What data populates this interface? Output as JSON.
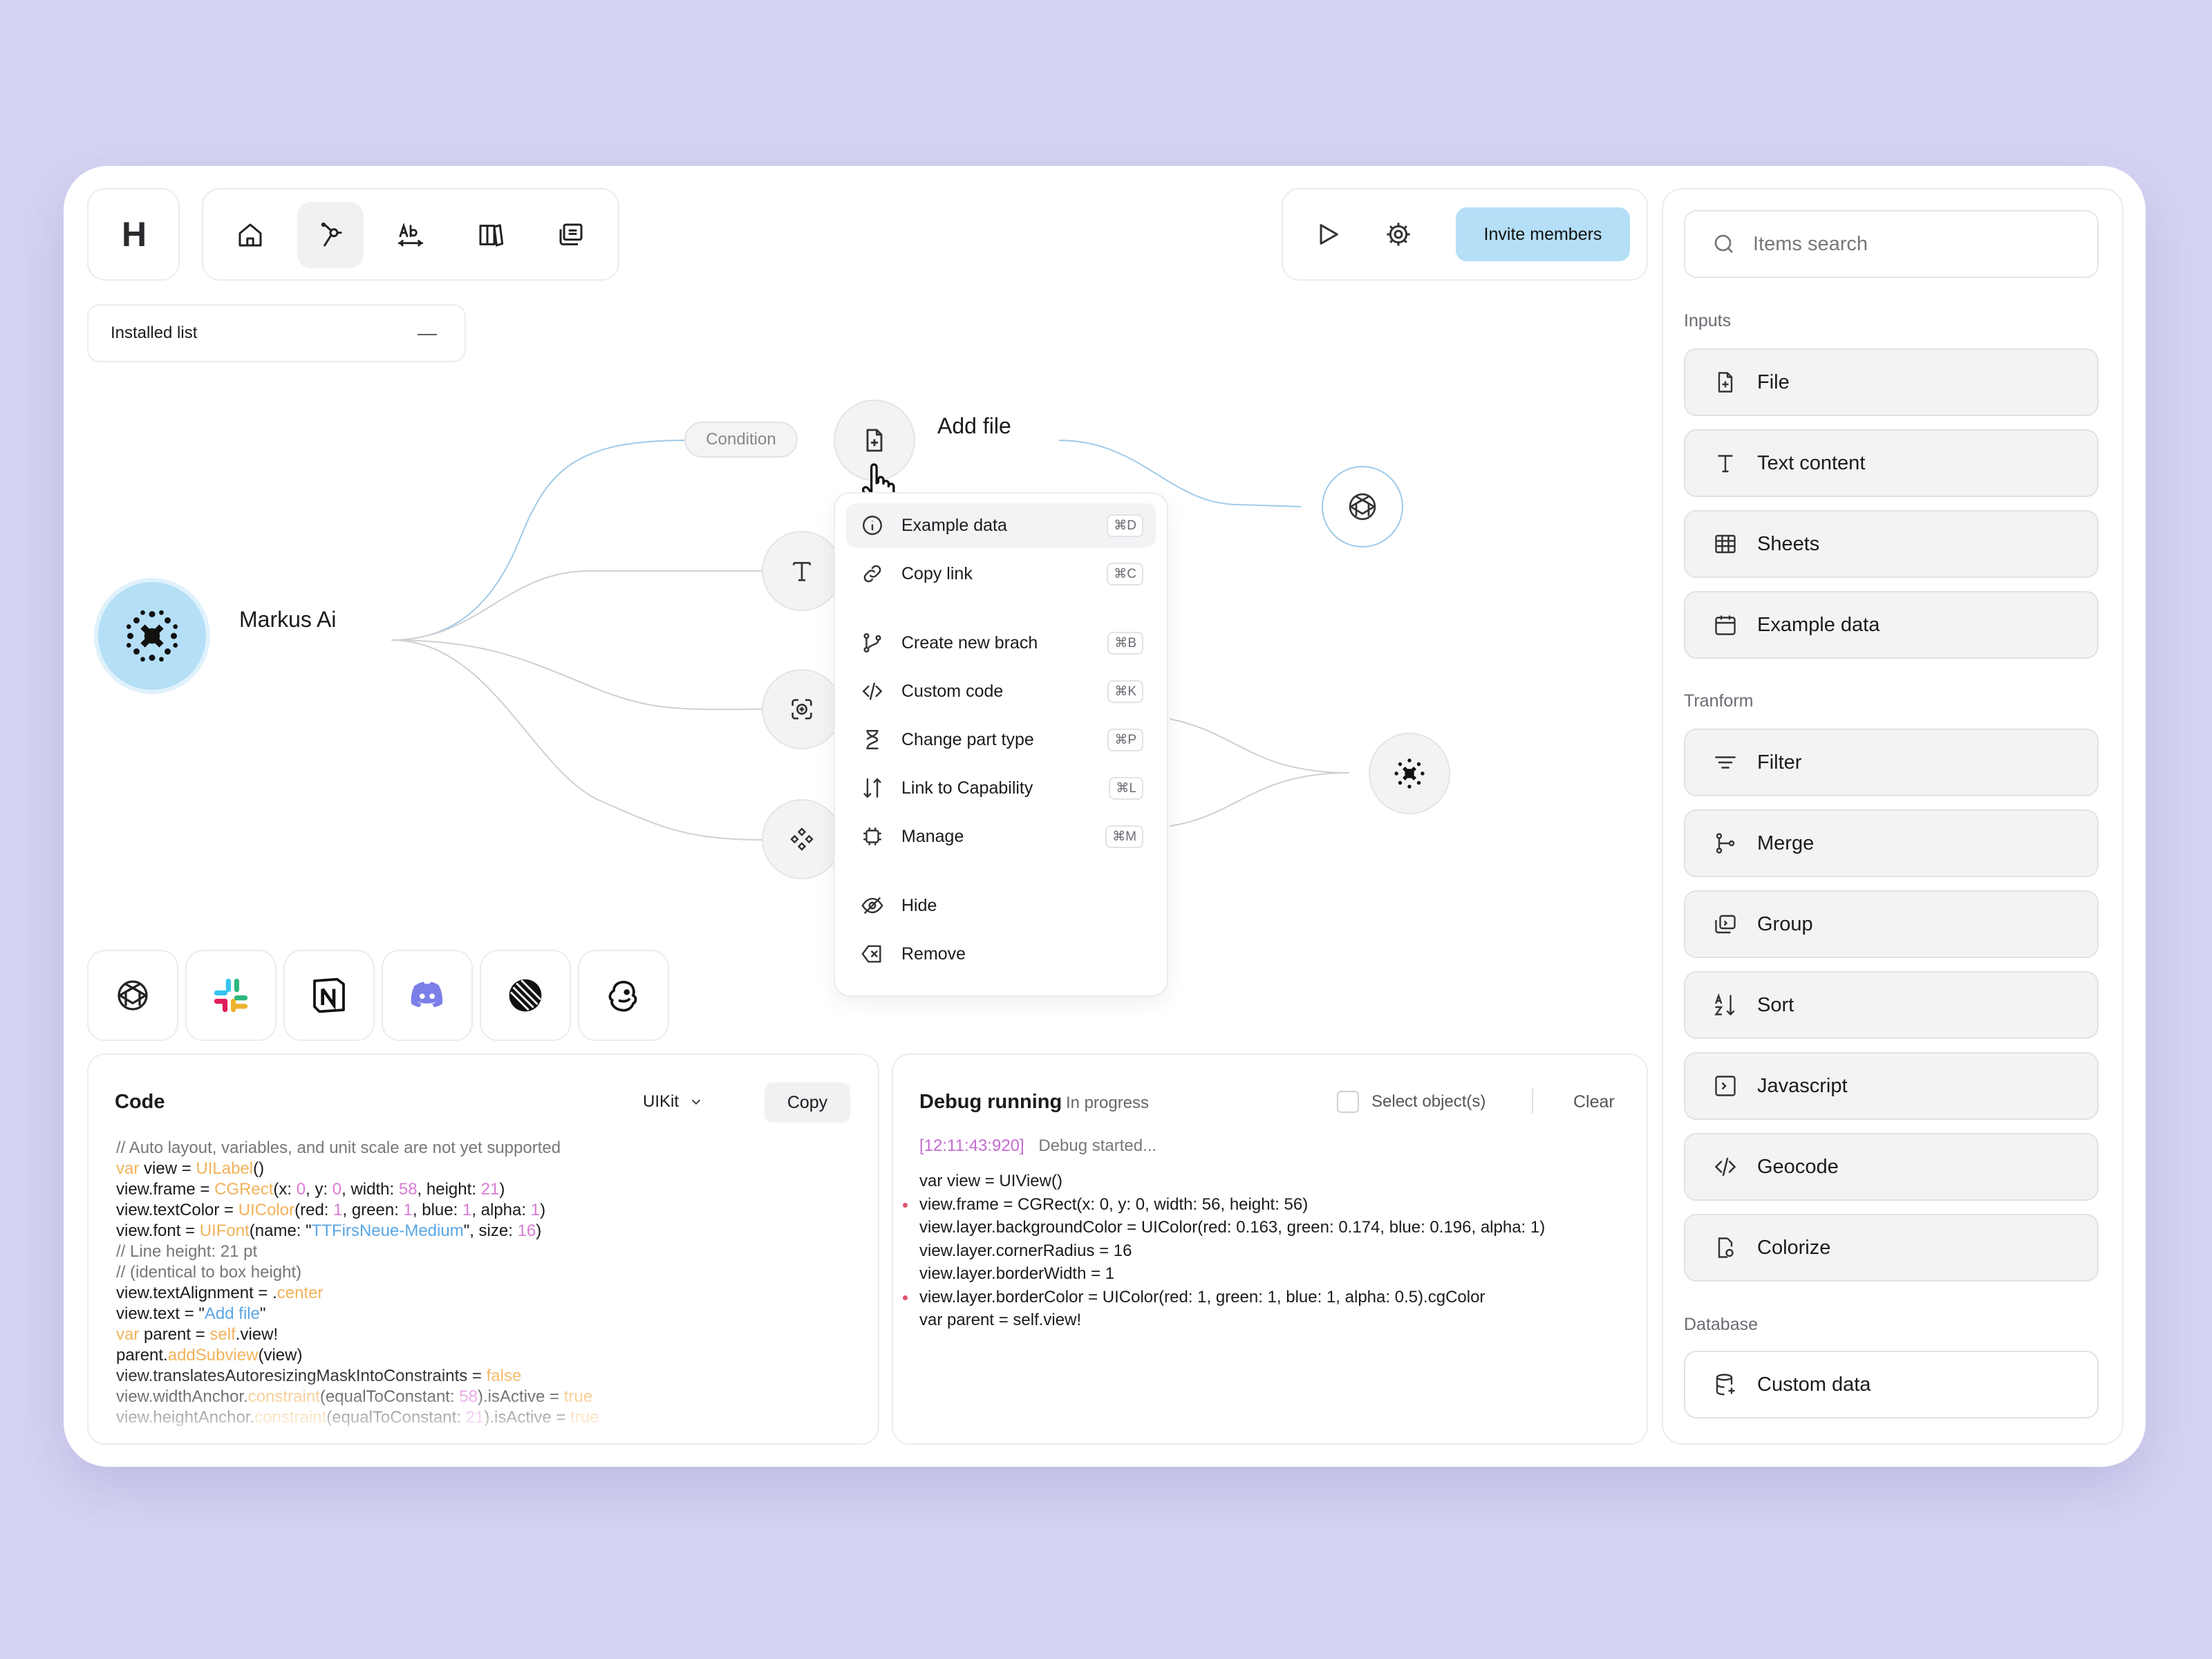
{
  "toolbar": {
    "logo": "H",
    "nav_icons": [
      "home-icon",
      "workflow-icon",
      "text-style-icon",
      "book-icon",
      "layers-icon"
    ],
    "play_icon": "play-icon",
    "settings_icon": "gear-icon",
    "invite_label": "Invite members"
  },
  "installed_list": {
    "label": "Installed list",
    "collapse_symbol": "—"
  },
  "canvas": {
    "root_node": "Markus Ai",
    "condition_label": "Condition",
    "add_file_label": "Add file"
  },
  "context_menu": {
    "items": [
      {
        "label": "Example data",
        "shortcut": "⌘D",
        "icon": "info-icon"
      },
      {
        "label": "Copy link",
        "shortcut": "⌘C",
        "icon": "link-icon"
      },
      {
        "label": "Create new brach",
        "shortcut": "⌘B",
        "icon": "branch-icon"
      },
      {
        "label": "Custom code",
        "shortcut": "⌘K",
        "icon": "code-icon"
      },
      {
        "label": "Change part type",
        "shortcut": "⌘P",
        "icon": "hourglass-icon"
      },
      {
        "label": "Link to Capability",
        "shortcut": "⌘L",
        "icon": "sort-arrows-icon"
      },
      {
        "label": "Manage",
        "shortcut": "⌘M",
        "icon": "chip-icon"
      },
      {
        "label": "Hide",
        "icon": "eye-off-icon"
      },
      {
        "label": "Remove",
        "icon": "delete-icon"
      }
    ]
  },
  "integrations": [
    "openai-icon",
    "slack-icon",
    "notion-icon",
    "discord-icon",
    "linear-icon",
    "mailchimp-icon"
  ],
  "code_panel": {
    "title": "Code",
    "framework": "UIKit",
    "copy_label": "Copy",
    "lines": [
      "// Auto layout, variables, and unit scale are not yet supported",
      "var view = UILabel()",
      "view.frame = CGRect(x: 0, y: 0, width: 58, height: 21)",
      "view.textColor = UIColor(red: 1, green: 1, blue: 1, alpha: 1)",
      "view.font = UIFont(name: \"TTFirsNeue-Medium\", size: 16)",
      "// Line height: 21 pt",
      "// (identical to box height)",
      "view.textAlignment = .center",
      "view.text = \"Add file\"",
      "var parent = self.view!",
      "parent.addSubview(view)",
      "view.translatesAutoresizingMaskIntoConstraints = false",
      "view.widthAnchor.constraint(equalToConstant: 58).isActive = true",
      "view.heightAnchor.constraint(equalToConstant: 21).isActive = true"
    ]
  },
  "debug_panel": {
    "title": "Debug running",
    "status": "In progress",
    "select_label": "Select object(s)",
    "clear_label": "Clear",
    "timestamp": "[12:11:43:920]",
    "started": "Debug started...",
    "lines": [
      "var view = UIView()",
      "view.frame = CGRect(x: 0, y: 0, width: 56, height: 56)",
      "view.layer.backgroundColor = UIColor(red: 0.163, green: 0.174, blue: 0.196, alpha: 1)",
      "view.layer.cornerRadius = 16",
      "view.layer.borderWidth = 1",
      "view.layer.borderColor = UIColor(red: 1, green: 1, blue: 1, alpha: 0.5).cgColor",
      "var parent = self.view!"
    ],
    "marked_lines": [
      1,
      5
    ]
  },
  "right_panel": {
    "search_placeholder": "Items search",
    "sections": [
      {
        "title": "Inputs",
        "items": [
          "File",
          "Text content",
          "Sheets",
          "Example data"
        ]
      },
      {
        "title": "Tranform",
        "items": [
          "Filter",
          "Merge",
          "Group",
          "Sort",
          "Javascript",
          "Geocode",
          "Colorize"
        ]
      },
      {
        "title": "Database",
        "items": [
          "Custom data"
        ]
      }
    ]
  },
  "colors": {
    "background": "#d6d4f3",
    "accent_blue": "#b4dff7",
    "code_keyword": "#f2b25a",
    "code_number": "#d97bd6",
    "code_string": "#5aa6e6",
    "debug_marker": "#e0536c",
    "debug_timestamp": "#c56bd0"
  }
}
